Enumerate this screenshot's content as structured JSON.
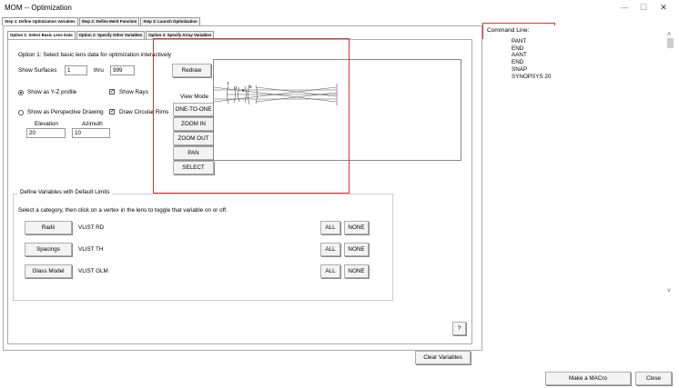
{
  "window": {
    "title": "MOM -- Optimization",
    "minimize": "—",
    "maximize": "☐",
    "close": "✕"
  },
  "outer_tabs": [
    "Step 1: Define Optimization Variables",
    "Step 2: Define Merit Function",
    "Step 3: Launch Optimization"
  ],
  "inner_tabs": [
    "Option 1: Select Basic Lens Data",
    "Option 2: Specify Other Variables",
    "Option 3: Specify Array Variables"
  ],
  "option1": {
    "heading": "Option 1: Select basic lens data for optimization interactively",
    "show_surfaces_label": "Show Surfaces",
    "surface_from": "1",
    "thru_label": "thru",
    "surface_to": "999",
    "redraw": "Redraw",
    "show_yz_label": "Show as Y-Z profile",
    "show_rays_label": "Show Rays",
    "show_perspective_label": "Show as Perspective Drawing",
    "draw_rims_label": "Draw Circular Rims",
    "elevation_label": "Elevation",
    "elevation_value": "20",
    "azimuth_label": "Azimuth",
    "azimuth_value": "10",
    "view_mode_label": "View Mode",
    "view_buttons": [
      "ONE-TO-ONE",
      "ZOOM IN",
      "ZOOM OUT",
      "PAN",
      "SELECT"
    ],
    "lens_labels": [
      "1",
      "3",
      "5",
      "6"
    ]
  },
  "variables": {
    "group_title": "Define Variables with Default Limits",
    "instructions": "Select a category, then click on a vertex in the lens to toggle that variable on or off.",
    "rows": [
      {
        "button": "Radii",
        "command": "VLIST RD",
        "all": "ALL",
        "none": "NONE"
      },
      {
        "button": "Spacings",
        "command": "VLIST TH",
        "all": "ALL",
        "none": "NONE"
      },
      {
        "button": "Glass Model",
        "command": "VLIST GLM",
        "all": "ALL",
        "none": "NONE"
      }
    ]
  },
  "help_button": "?",
  "clear_variables": "Clear Variables",
  "command_line": {
    "label": "Command Line:",
    "lines": [
      "PANT",
      "END",
      "AANT",
      "END",
      "SNAP",
      "SYNOPSYS 20"
    ]
  },
  "bottom": {
    "make_macro": "Make a MACro",
    "close": "Close"
  },
  "colors": {
    "highlight": "#e8302a",
    "lens_surface": "#c040c0"
  }
}
